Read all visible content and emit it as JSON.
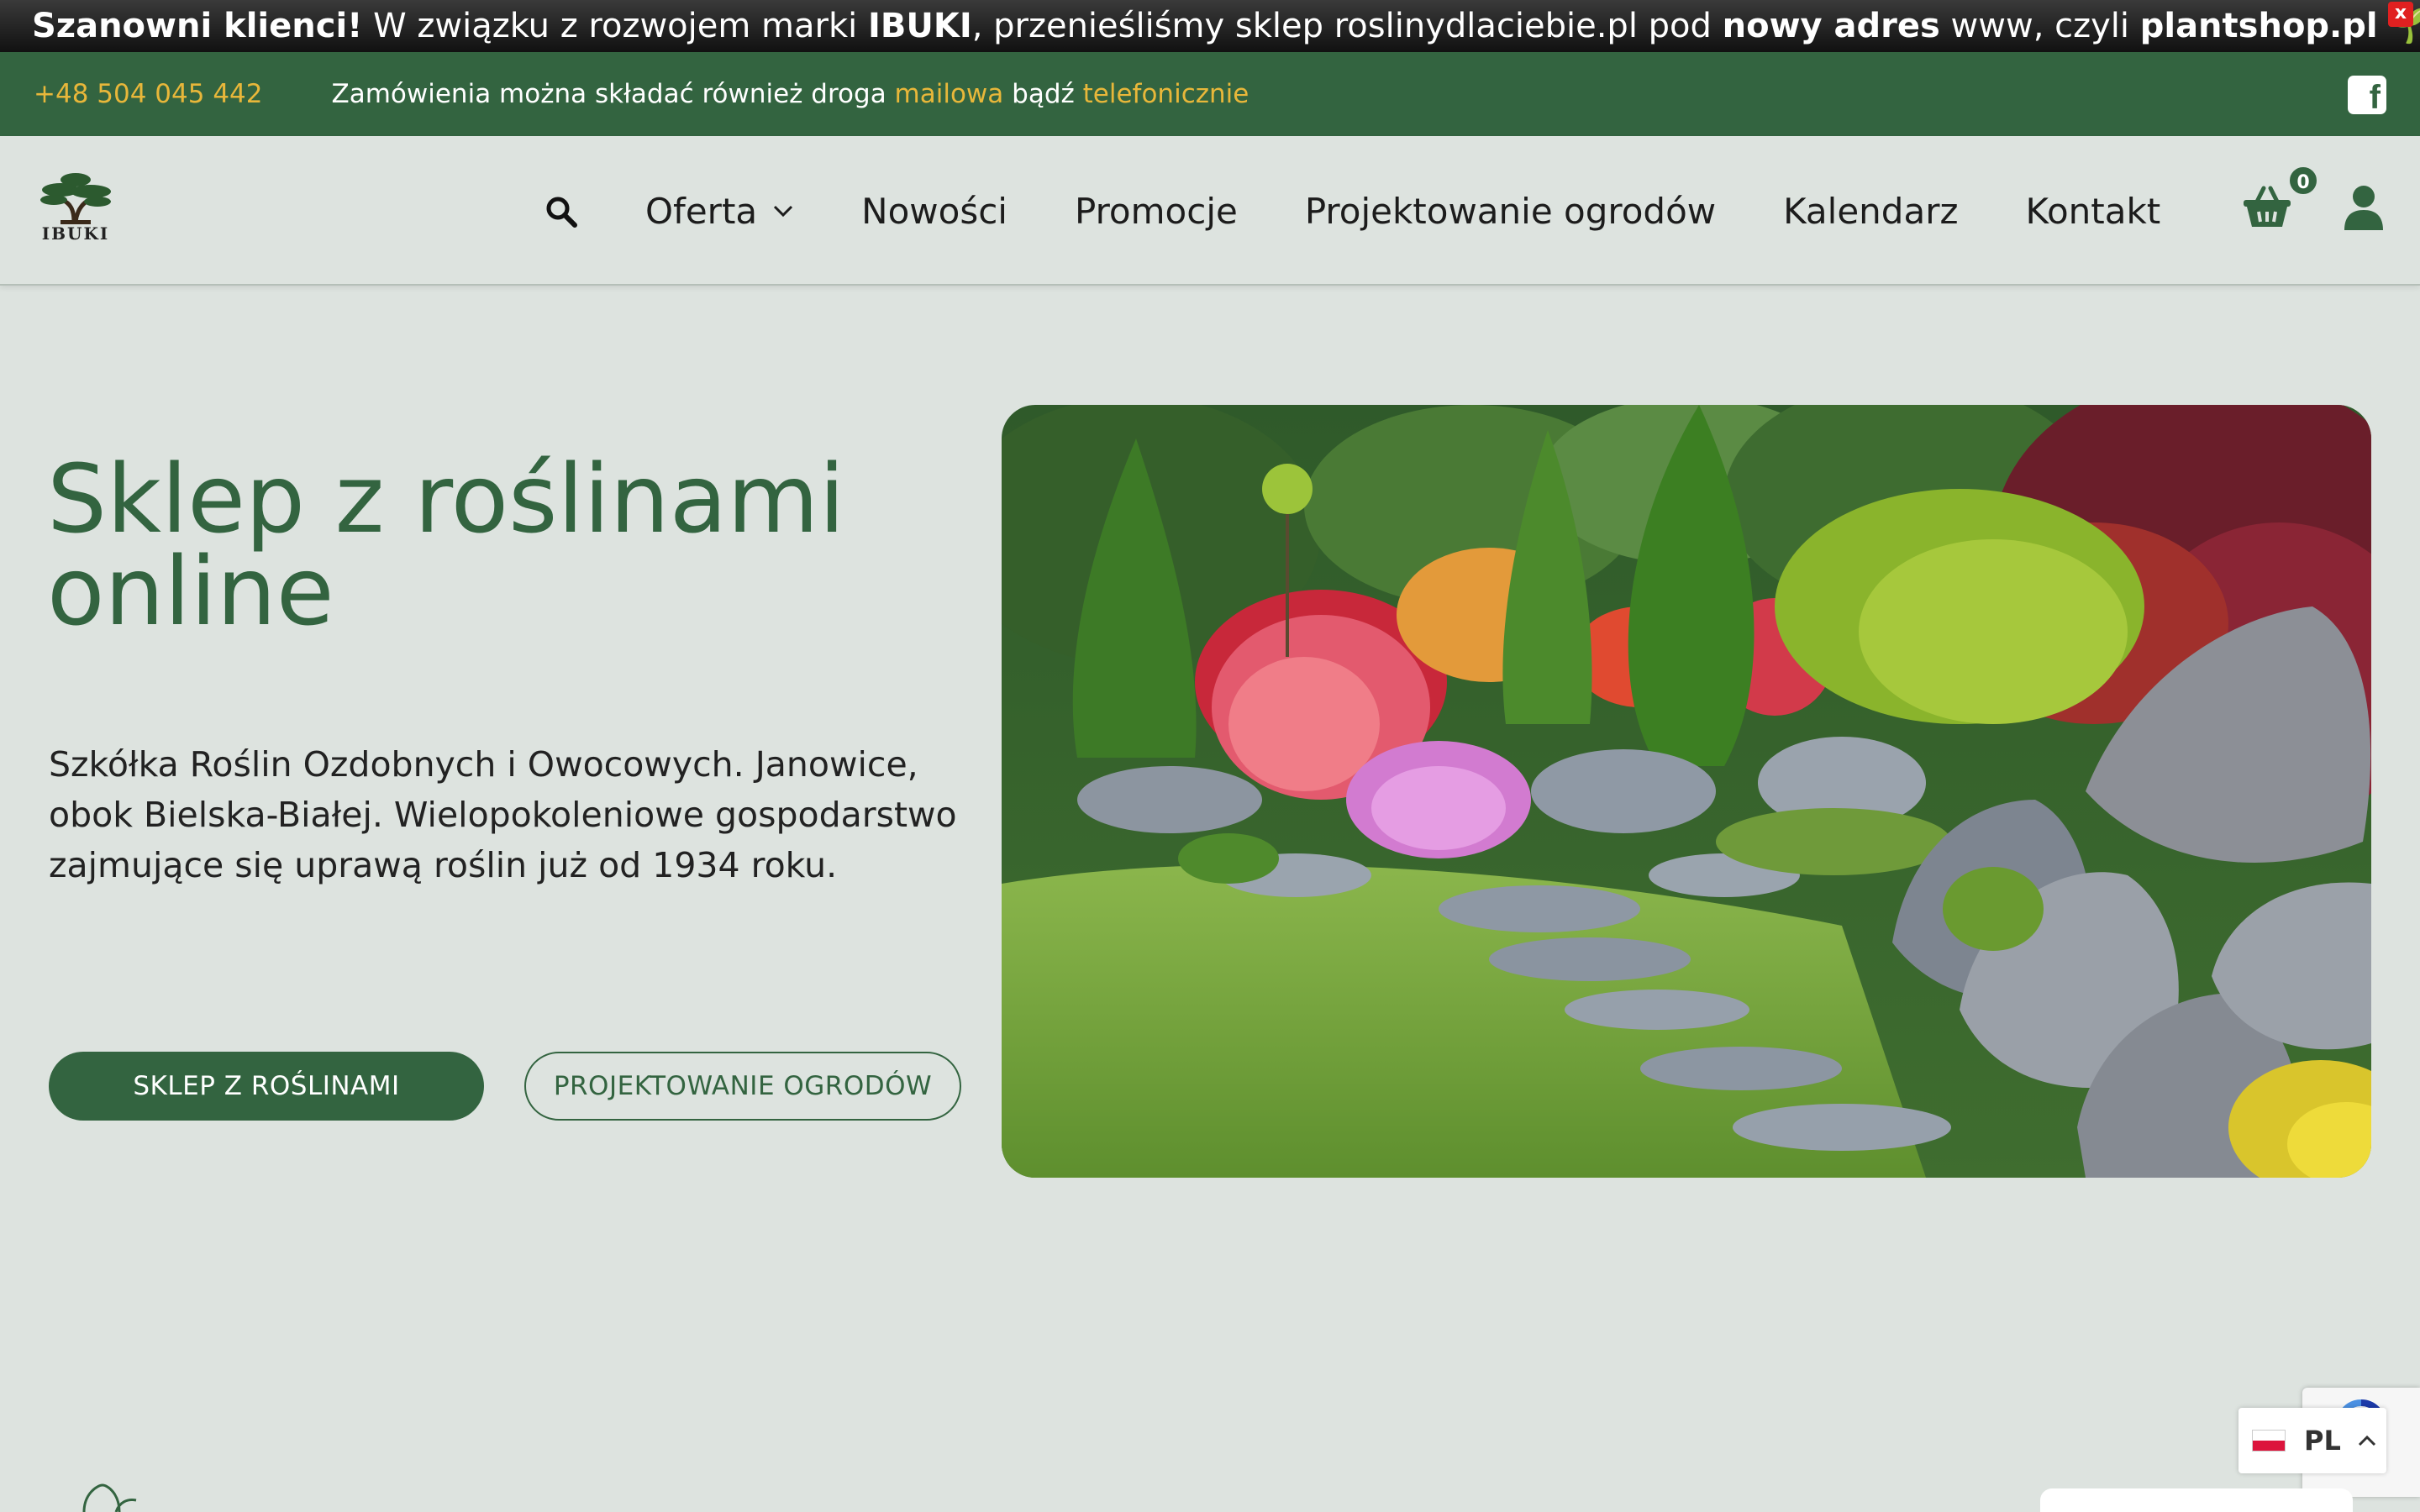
{
  "notice": {
    "part1": "Szanowni klienci!",
    "part2": " W związku z rozwojem marki ",
    "part3": "IBUKI",
    "part4": ", przenieśliśmy sklep roslinydlaciebie.pl pod ",
    "part5": "nowy adres",
    "part6": " www, czyli ",
    "part7": "plantshop.pl",
    "close": "x"
  },
  "topbar": {
    "phone": "+48 504 045 442",
    "orders_prefix": "Zamówienia można składać również droga ",
    "orders_mail": "mailowa",
    "orders_mid": " bądź ",
    "orders_phone": "telefonicznie"
  },
  "logo": {
    "text": "IBUKI"
  },
  "nav": {
    "items": [
      "Oferta",
      "Nowości",
      "Promocje",
      "Projektowanie ogrodów",
      "Kalendarz",
      "Kontakt"
    ]
  },
  "cart": {
    "count": "0"
  },
  "hero": {
    "title_line1": "Sklep z roślinami",
    "title_line2": "online",
    "description": "Szkółka Roślin Ozdobnych i Owocowych. Janowice, obok Bielska-Białej. Wielopokoleniowe gospodarstwo zajmujące się uprawą roślin już od 1934 roku.",
    "btn_primary": "SKLEP Z ROŚLINAMI",
    "btn_secondary": "PROJEKTOWANIE OGRODÓW"
  },
  "language": {
    "code": "PL"
  },
  "colors": {
    "brand_green": "#336440",
    "accent_gold": "#e8b73a",
    "background": "#dde3df"
  }
}
